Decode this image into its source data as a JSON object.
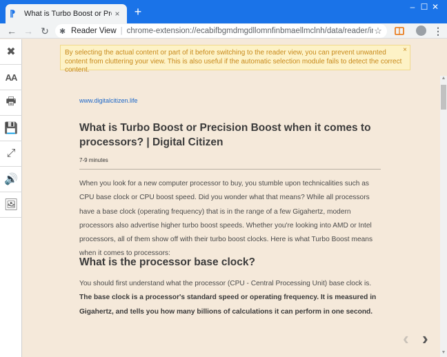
{
  "browser": {
    "tab_title": "What is Turbo Boost or Precision",
    "tab_close": "×",
    "new_tab": "+",
    "window_controls": [
      "–",
      "☐",
      "✕"
    ],
    "omnibox_label": "Reader View",
    "omnibox_separator": "|",
    "omnibox_url": "chrome-extension://ecabifbgmdmgdllomnfinbmaellmclnh/data/reader/index....",
    "menu": "⋮"
  },
  "sidebar": {
    "items": [
      {
        "name": "close",
        "glyph": "✖"
      },
      {
        "name": "font-size",
        "glyph": "AA"
      },
      {
        "name": "print",
        "glyph": "🖶"
      },
      {
        "name": "save",
        "glyph": "💾"
      },
      {
        "name": "fullscreen",
        "glyph": "⤢"
      },
      {
        "name": "speak",
        "glyph": "🔊"
      },
      {
        "name": "images",
        "glyph": "🖼"
      }
    ]
  },
  "notice": {
    "text": "By selecting the actual content or part of it before switching to the reader view, you can prevent unwanted content from cluttering your view. This is also useful if the automatic selection module fails to detect the correct content.",
    "close": "×"
  },
  "article": {
    "source": "www.digitalcitizen.life",
    "title": "What is Turbo Boost or Precision Boost when it comes to processors? | Digital Citizen",
    "read_time": "7-9 minutes",
    "para1": "When you look for a new computer processor to buy, you stumble upon technicalities such as CPU base clock or CPU boost speed. Did you wonder what that means? While all processors have a base clock (operating frequency) that is in the range of a few Gigahertz, modern processors also advertise higher turbo boost speeds. Whether you're looking into AMD or Intel processors, all of them show off with their turbo boost clocks. Here is what Turbo Boost means when it comes to processors:",
    "heading2": "What is the processor base clock?",
    "para2_plain": "You should first understand what the processor (CPU - Central Processing Unit) base clock is. ",
    "para2_bold": "The base clock is a processor's standard speed or operating frequency. It is measured in Gigahertz, and tells you how many billions of calculations it can perform in one second"
  },
  "paging": {
    "prev": "‹",
    "next": "›"
  }
}
